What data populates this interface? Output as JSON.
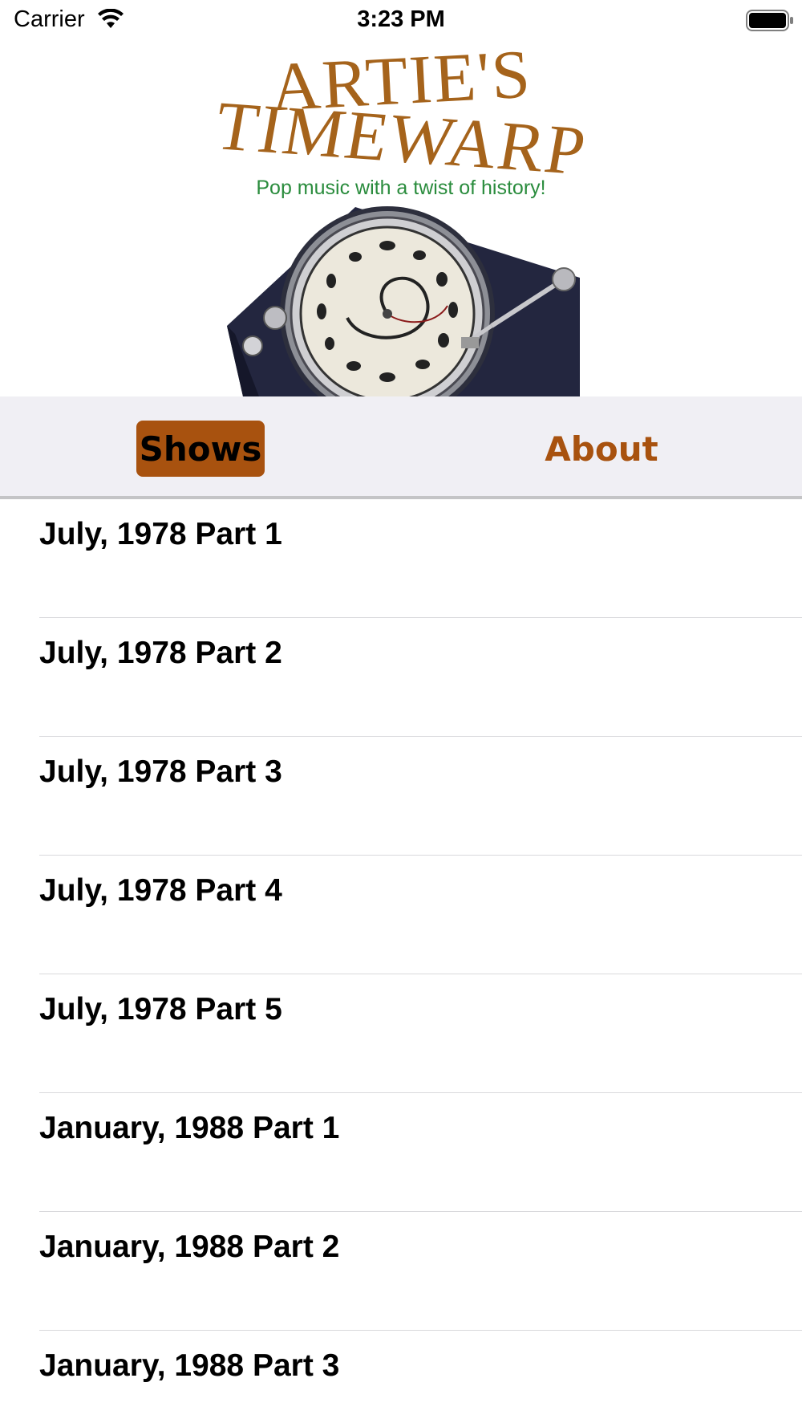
{
  "status_bar": {
    "carrier": "Carrier",
    "time": "3:23 PM"
  },
  "header": {
    "logo_line_1": "ARTIE'S",
    "logo_line_2": "TIMEWARP",
    "tagline": "Pop music with a twist of history!",
    "logo_color": "#a5631b",
    "tagline_color": "#2a8c3d"
  },
  "tabs": [
    {
      "label": "Shows",
      "selected": true
    },
    {
      "label": "About",
      "selected": false
    }
  ],
  "accent_color": "#a8520f",
  "shows": [
    {
      "title": "July, 1978 Part 1"
    },
    {
      "title": "July, 1978 Part 2"
    },
    {
      "title": "July, 1978 Part 3"
    },
    {
      "title": "July, 1978 Part 4"
    },
    {
      "title": "July, 1978 Part 5"
    },
    {
      "title": "January, 1988 Part 1"
    },
    {
      "title": "January, 1988 Part 2"
    },
    {
      "title": "January, 1988 Part 3"
    }
  ]
}
